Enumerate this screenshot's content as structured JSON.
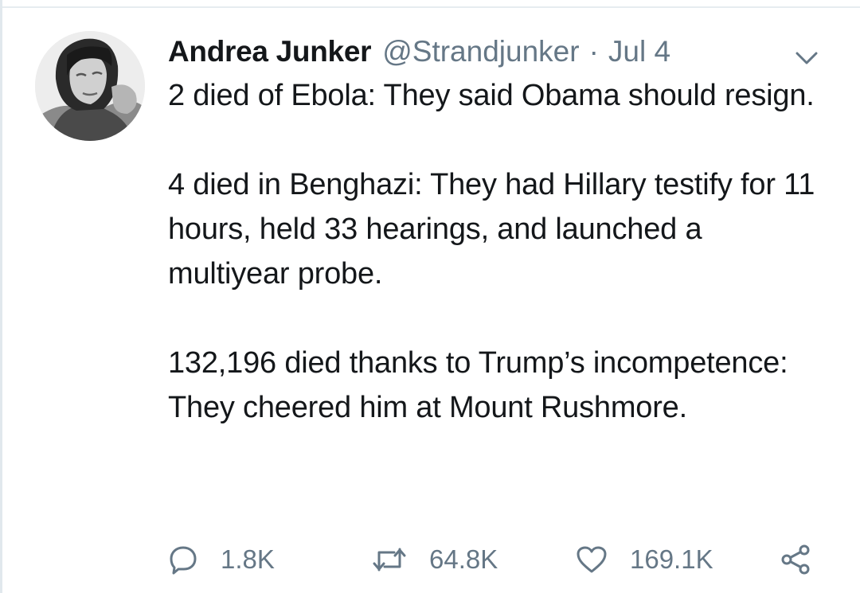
{
  "tweet": {
    "author": {
      "display_name": "Andrea Junker",
      "handle": "@Strandjunker",
      "avatar_icon": "profile-photo"
    },
    "separator": "·",
    "date": "Jul 4",
    "menu_icon": "chevron-down-icon",
    "text": "2 died of Ebola: They said Obama should resign.\n\n4 died in Benghazi: They had Hillary testify for 11 hours, held 33 hearings, and launched a multiyear probe.\n\n132,196 died thanks to Trump’s incompetence: They cheered him at Mount Rushmore.",
    "actions": {
      "reply": {
        "icon": "reply-icon",
        "count": "1.8K"
      },
      "retweet": {
        "icon": "retweet-icon",
        "count": "64.8K"
      },
      "like": {
        "icon": "heart-icon",
        "count": "169.1K"
      },
      "share": {
        "icon": "share-icon"
      }
    }
  },
  "colors": {
    "text": "#14171a",
    "muted": "#657786",
    "divider": "#e6ecf0",
    "background": "#ffffff"
  }
}
